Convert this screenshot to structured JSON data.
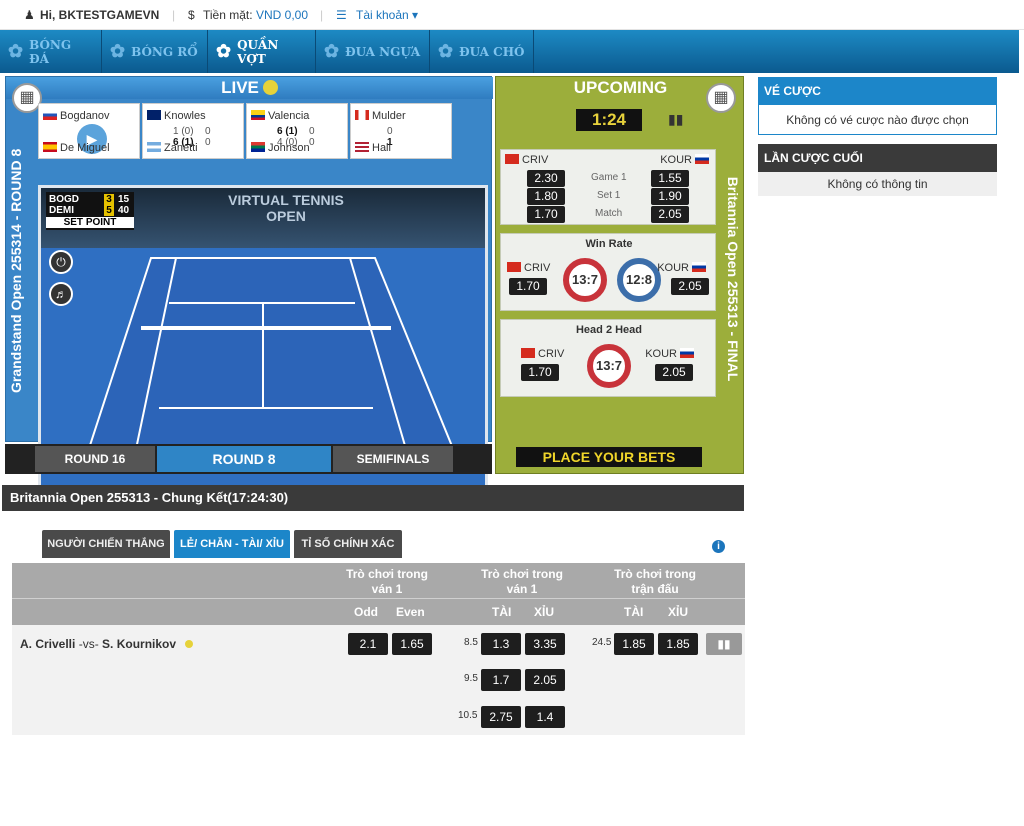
{
  "topbar": {
    "greeting": "Hi, BKTESTGAMEVN",
    "cash_label": "Tiền mặt:",
    "cash_value": "VND 0,00",
    "account": "Tài khoản"
  },
  "nav": [
    "BÓNG ĐÁ",
    "BÓNG RỔ",
    "QUẦN VỢT",
    "ĐUA NGỰA",
    "ĐUA CHÓ"
  ],
  "live": {
    "title": "LIVE",
    "cards": [
      {
        "p1": "Bogdanov",
        "p2": "De Miguel"
      },
      {
        "p1": "Knowles",
        "p2": "Zanetti",
        "s1a": "1 (0)",
        "s1b": "0",
        "s2a": "6 (1)",
        "s2b": "0"
      },
      {
        "p1": "Valencia",
        "p2": "Johnson",
        "s1a": "6 (1)",
        "s1b": "0",
        "s2a": "4 (0)",
        "s2b": "0"
      },
      {
        "p1": "Mulder",
        "p2": "Hall",
        "s1a": "0",
        "s2a": "1"
      }
    ],
    "scoreboard": {
      "p1": "BOGD",
      "p2": "DEMI",
      "p1g": "3",
      "p1p": "15",
      "p2g": "5",
      "p2p": "40",
      "status": "SET POINT"
    },
    "banner": "VIRTUAL TENNIS OPEN",
    "left_label": "Grandstand Open 255314 - ROUND 8",
    "rounds": [
      "ROUND 16",
      "ROUND 8",
      "SEMIFINALS"
    ]
  },
  "upcoming": {
    "title": "UPCOMING",
    "timer": "1:24",
    "right_label": "Britannia Open 255313 - FINAL",
    "p1": "CRIV",
    "p2": "KOUR",
    "odds": [
      {
        "l": "2.30",
        "m": "Game 1",
        "r": "1.55"
      },
      {
        "l": "1.80",
        "m": "Set 1",
        "r": "1.90"
      },
      {
        "l": "1.70",
        "m": "Match",
        "r": "2.05"
      }
    ],
    "winrate": {
      "title": "Win Rate",
      "l": "1.70",
      "r": "2.05",
      "ring1": "13:7",
      "ring2": "12:8"
    },
    "h2h": {
      "title": "Head 2 Head",
      "l": "1.70",
      "r": "2.05",
      "ring": "13:7"
    },
    "cta": "PLACE YOUR BETS"
  },
  "slip": {
    "title": "VÉ CƯỢC",
    "empty": "Không có vé cược nào được chọn",
    "last_title": "LẦN CƯỢC CUỐI",
    "last_empty": "Không có thông tin"
  },
  "event": {
    "title": "Britannia Open 255313 - Chung Kết(17:24:30)",
    "tabs": [
      "NGƯỜI CHIẾN THẮNG",
      "LẺ/ CHẴN - TÀI/ XỈU",
      "TỈ SỐ CHÍNH XÁC"
    ],
    "col1": "Trò chơi trong ván 1",
    "col2": "Trò chơi trong ván 1",
    "col3": "Trò chơi trong trận đấu",
    "odd": "Odd",
    "even": "Even",
    "tai": "TÀI",
    "xiu": "XỈU",
    "player1": "A. Crivelli",
    "vs": "-vs-",
    "player2": "S. Kournikov",
    "oe": [
      "2.1",
      "1.65"
    ],
    "ou1": [
      {
        "h": "8.5",
        "a": "1.3",
        "b": "3.35"
      },
      {
        "h": "9.5",
        "a": "1.7",
        "b": "2.05"
      },
      {
        "h": "10.5",
        "a": "2.75",
        "b": "1.4"
      }
    ],
    "ou2": {
      "h": "24.5",
      "a": "1.85",
      "b": "1.85"
    }
  }
}
